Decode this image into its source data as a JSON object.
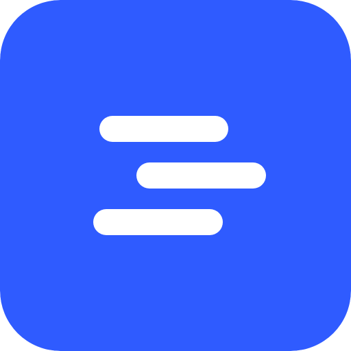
{
  "icon": {
    "name": "menu-lines-icon",
    "background_color": "#2F5BFF",
    "foreground_color": "#FFFFFF"
  }
}
